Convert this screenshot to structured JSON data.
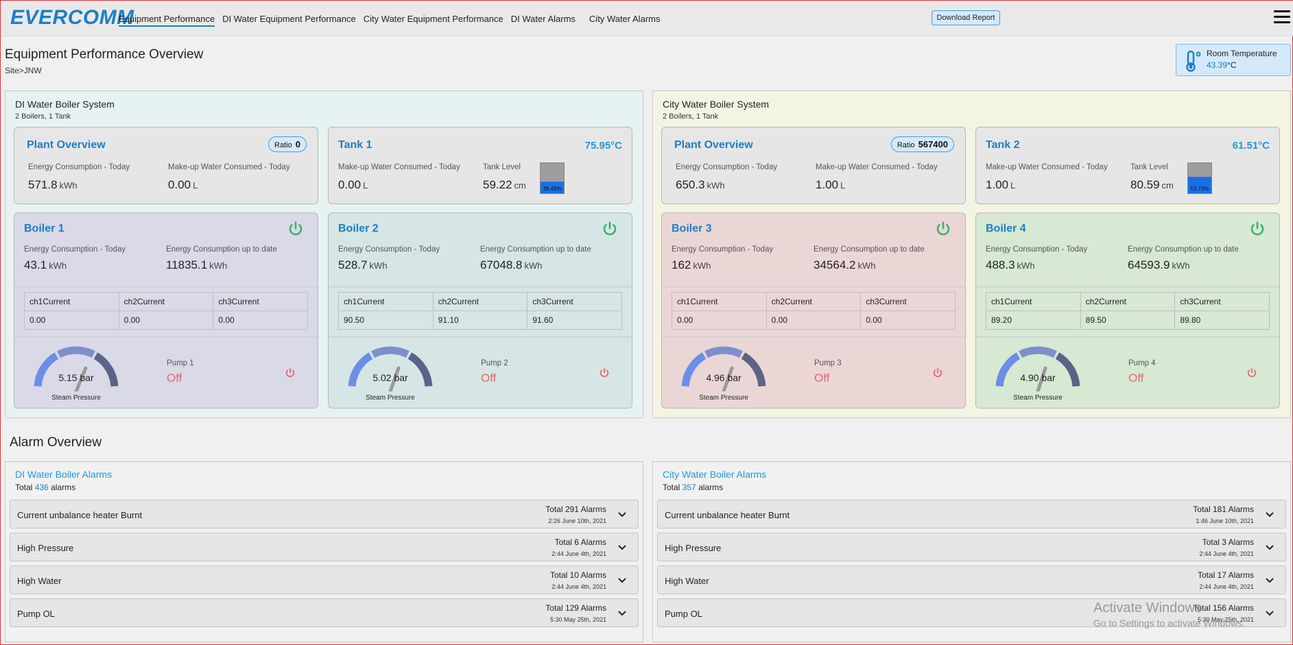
{
  "header": {
    "logo": "EVERCOMM",
    "nav": [
      "Equipment Performance",
      "DI Water Equipment Performance",
      "City Water Equipment Performance",
      "DI Water Alarms",
      "City Water Alarms"
    ],
    "download": "Download Report",
    "menu_icon": "hamburger-icon"
  },
  "page": {
    "title": "Equipment Performance Overview",
    "breadcrumb": "Site>JNW"
  },
  "room_temperature": {
    "label": "Room Temperature",
    "value": "43.39",
    "unit": "°C",
    "icon": "thermometer-icon"
  },
  "di": {
    "title": "DI Water Boiler System",
    "subtitle": "2 Boilers, 1 Tank",
    "plant": {
      "title": "Plant Overview",
      "ratio_label": "Ratio",
      "ratio": "0",
      "energy_label": "Energy Consumption - Today",
      "energy": "571.8",
      "energy_unit": "kWh",
      "water_label": "Make-up Water Consumed - Today",
      "water": "0.00",
      "water_unit": "L"
    },
    "tank": {
      "title": "Tank 1",
      "temp": "75.95°C",
      "water_label": "Make-up Water Consumed - Today",
      "water": "0.00",
      "water_unit": "L",
      "level_label": "Tank Level",
      "level": "59.22",
      "level_unit": "cm",
      "pct_text": "39.48%",
      "fill": 0.3948
    },
    "boilers": [
      {
        "title": "Boiler 1",
        "energy_today_label": "Energy Consumption - Today",
        "energy_today": "43.1",
        "energy_unit": "kWh",
        "energy_total_label": "Energy Consumption up to date",
        "energy_total": "11835.1",
        "ch_labels": [
          "ch1Current",
          "ch2Current",
          "ch3Current"
        ],
        "ch_values": [
          "0.00",
          "0.00",
          "0.00"
        ],
        "gauge_value": "5.15 bar",
        "gauge_fraction": 0.52,
        "gauge_label": "Steam Pressure",
        "pump_label": "Pump 1",
        "pump_state": "Off",
        "bg": "#d9d9e8"
      },
      {
        "title": "Boiler 2",
        "energy_today_label": "Energy Consumption - Today",
        "energy_today": "528.7",
        "energy_unit": "kWh",
        "energy_total_label": "Energy Consumption up to date",
        "energy_total": "67048.8",
        "ch_labels": [
          "ch1Current",
          "ch2Current",
          "ch3Current"
        ],
        "ch_values": [
          "90.50",
          "91.10",
          "91.60"
        ],
        "gauge_value": "5.02 bar",
        "gauge_fraction": 0.5,
        "gauge_label": "Steam Pressure",
        "pump_label": "Pump 2",
        "pump_state": "Off",
        "bg": "#d6e6e4"
      }
    ]
  },
  "city": {
    "title": "City Water Boiler System",
    "subtitle": "2 Boilers, 1 Tank",
    "plant": {
      "title": "Plant Overview",
      "ratio_label": "Ratio",
      "ratio": "567400",
      "energy_label": "Energy Consumption - Today",
      "energy": "650.3",
      "energy_unit": "kWh",
      "water_label": "Make-up Water Consumed - Today",
      "water": "1.00",
      "water_unit": "L"
    },
    "tank": {
      "title": "Tank 2",
      "temp": "61.51°C",
      "water_label": "Make-up Water Consumed - Today",
      "water": "1.00",
      "water_unit": "L",
      "level_label": "Tank Level",
      "level": "80.59",
      "level_unit": "cm",
      "pct_text": "53.73%",
      "fill": 0.5373
    },
    "boilers": [
      {
        "title": "Boiler 3",
        "energy_today_label": "Energy Consumption - Today",
        "energy_today": "162",
        "energy_unit": "kWh",
        "energy_total_label": "Energy Consumption up to date",
        "energy_total": "34564.2",
        "ch_labels": [
          "ch1Current",
          "ch2Current",
          "ch3Current"
        ],
        "ch_values": [
          "0.00",
          "0.00",
          "0.00"
        ],
        "gauge_value": "4.96 bar",
        "gauge_fraction": 0.5,
        "gauge_label": "Steam Pressure",
        "pump_label": "Pump 3",
        "pump_state": "Off",
        "bg": "#ebd6d6"
      },
      {
        "title": "Boiler 4",
        "energy_today_label": "Energy Consumption - Today",
        "energy_today": "488.3",
        "energy_unit": "kWh",
        "energy_total_label": "Energy Consumption up to date",
        "energy_total": "64593.9",
        "ch_labels": [
          "ch1Current",
          "ch2Current",
          "ch3Current"
        ],
        "ch_values": [
          "89.20",
          "89.50",
          "89.80"
        ],
        "gauge_value": "4.90 bar",
        "gauge_fraction": 0.49,
        "gauge_label": "Steam Pressure",
        "pump_label": "Pump 4",
        "pump_state": "Off",
        "bg": "#d7e8d3"
      }
    ]
  },
  "alarms": {
    "title": "Alarm Overview",
    "di": {
      "title": "DI Water Boiler Alarms",
      "total_prefix": "Total",
      "total": "436",
      "total_suffix": "alarms",
      "rows": [
        {
          "name": "Current unbalance heater Burnt",
          "total": "Total 291 Alarms",
          "date": "2:26 June 10th, 2021"
        },
        {
          "name": "High Pressure",
          "total": "Total 6 Alarms",
          "date": "2:44 June 4th, 2021"
        },
        {
          "name": "High Water",
          "total": "Total 10 Alarms",
          "date": "2:44 June 4th, 2021"
        },
        {
          "name": "Pump OL",
          "total": "Total 129 Alarms",
          "date": "5:30 May 25th, 2021"
        }
      ]
    },
    "city": {
      "title": "City Water Boiler Alarms",
      "total_prefix": "Total",
      "total": "357",
      "total_suffix": "alarms",
      "rows": [
        {
          "name": "Current unbalance heater Burnt",
          "total": "Total 181 Alarms",
          "date": "1:46 June 10th, 2021"
        },
        {
          "name": "High Pressure",
          "total": "Total 3 Alarms",
          "date": "2:44 June 4th, 2021"
        },
        {
          "name": "High Water",
          "total": "Total 17 Alarms",
          "date": "2:44 June 4th, 2021"
        },
        {
          "name": "Pump OL",
          "total": "Total 156 Alarms",
          "date": "5:30 May 25th, 2021"
        }
      ]
    }
  },
  "watermark": {
    "line1": "Activate Windows",
    "line2": "Go to Settings to activate Windows."
  },
  "colors": {
    "accent": "#1c7fc4",
    "power_on": "#3bb36b",
    "pump_off": "#e26a6a",
    "tank_fill": "#1a6fe8"
  }
}
